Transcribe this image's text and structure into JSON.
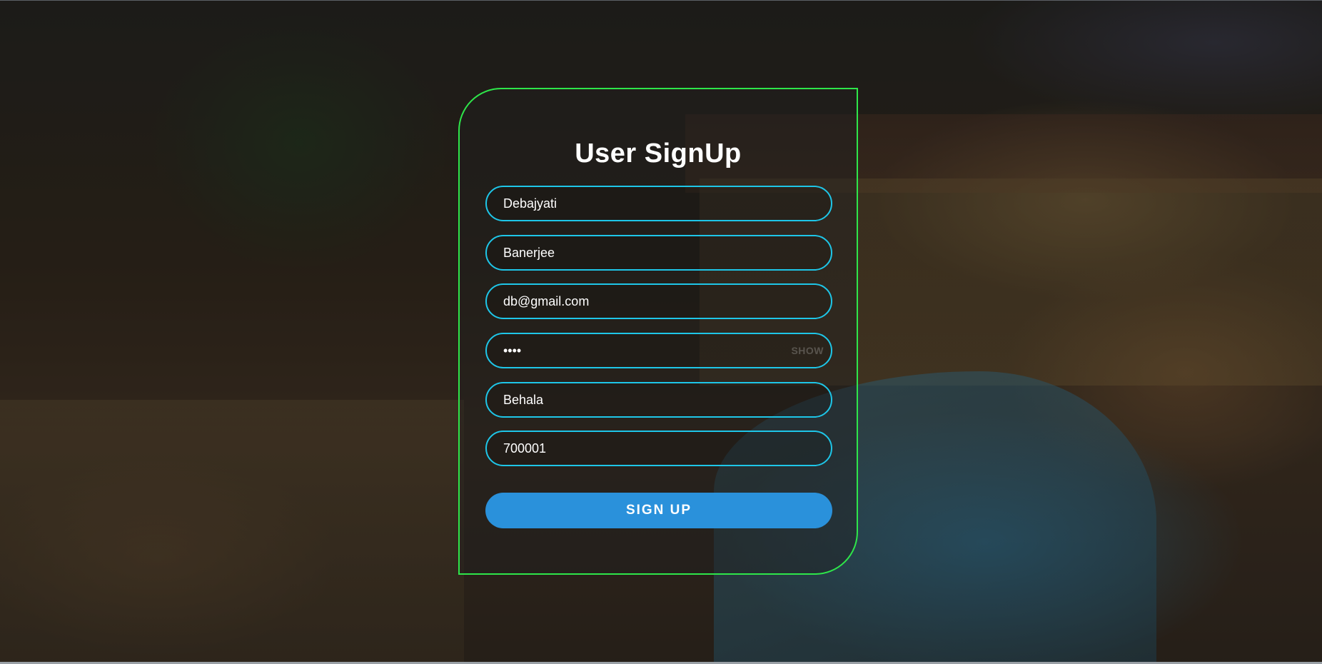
{
  "form": {
    "title": "User SignUp",
    "fields": [
      {
        "name": "first-name",
        "value": "Debajyati"
      },
      {
        "name": "last-name",
        "value": "Banerjee"
      },
      {
        "name": "email",
        "value": "db@gmail.com"
      },
      {
        "name": "password",
        "value": "••••",
        "toggle_label": "SHOW"
      },
      {
        "name": "city",
        "value": "Behala"
      },
      {
        "name": "pincode",
        "value": "700001"
      }
    ],
    "submit_label": "SIGN UP"
  },
  "colors": {
    "card_border": "#2ee64a",
    "field_border": "#1ec6e8",
    "button_bg": "#2a91db",
    "text": "#ffffff"
  }
}
